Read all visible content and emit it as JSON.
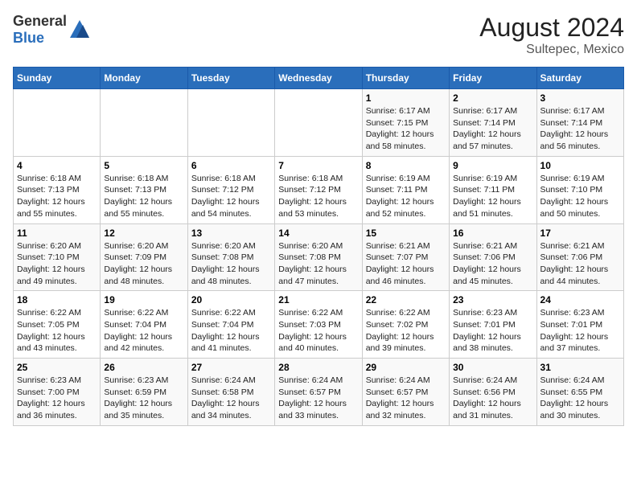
{
  "header": {
    "logo_general": "General",
    "logo_blue": "Blue",
    "title": "August 2024",
    "subtitle": "Sultepec, Mexico"
  },
  "days_of_week": [
    "Sunday",
    "Monday",
    "Tuesday",
    "Wednesday",
    "Thursday",
    "Friday",
    "Saturday"
  ],
  "weeks": [
    [
      {
        "day": "",
        "info": ""
      },
      {
        "day": "",
        "info": ""
      },
      {
        "day": "",
        "info": ""
      },
      {
        "day": "",
        "info": ""
      },
      {
        "day": "1",
        "info": "Sunrise: 6:17 AM\nSunset: 7:15 PM\nDaylight: 12 hours and 58 minutes."
      },
      {
        "day": "2",
        "info": "Sunrise: 6:17 AM\nSunset: 7:14 PM\nDaylight: 12 hours and 57 minutes."
      },
      {
        "day": "3",
        "info": "Sunrise: 6:17 AM\nSunset: 7:14 PM\nDaylight: 12 hours and 56 minutes."
      }
    ],
    [
      {
        "day": "4",
        "info": "Sunrise: 6:18 AM\nSunset: 7:13 PM\nDaylight: 12 hours and 55 minutes."
      },
      {
        "day": "5",
        "info": "Sunrise: 6:18 AM\nSunset: 7:13 PM\nDaylight: 12 hours and 55 minutes."
      },
      {
        "day": "6",
        "info": "Sunrise: 6:18 AM\nSunset: 7:12 PM\nDaylight: 12 hours and 54 minutes."
      },
      {
        "day": "7",
        "info": "Sunrise: 6:18 AM\nSunset: 7:12 PM\nDaylight: 12 hours and 53 minutes."
      },
      {
        "day": "8",
        "info": "Sunrise: 6:19 AM\nSunset: 7:11 PM\nDaylight: 12 hours and 52 minutes."
      },
      {
        "day": "9",
        "info": "Sunrise: 6:19 AM\nSunset: 7:11 PM\nDaylight: 12 hours and 51 minutes."
      },
      {
        "day": "10",
        "info": "Sunrise: 6:19 AM\nSunset: 7:10 PM\nDaylight: 12 hours and 50 minutes."
      }
    ],
    [
      {
        "day": "11",
        "info": "Sunrise: 6:20 AM\nSunset: 7:10 PM\nDaylight: 12 hours and 49 minutes."
      },
      {
        "day": "12",
        "info": "Sunrise: 6:20 AM\nSunset: 7:09 PM\nDaylight: 12 hours and 48 minutes."
      },
      {
        "day": "13",
        "info": "Sunrise: 6:20 AM\nSunset: 7:08 PM\nDaylight: 12 hours and 48 minutes."
      },
      {
        "day": "14",
        "info": "Sunrise: 6:20 AM\nSunset: 7:08 PM\nDaylight: 12 hours and 47 minutes."
      },
      {
        "day": "15",
        "info": "Sunrise: 6:21 AM\nSunset: 7:07 PM\nDaylight: 12 hours and 46 minutes."
      },
      {
        "day": "16",
        "info": "Sunrise: 6:21 AM\nSunset: 7:06 PM\nDaylight: 12 hours and 45 minutes."
      },
      {
        "day": "17",
        "info": "Sunrise: 6:21 AM\nSunset: 7:06 PM\nDaylight: 12 hours and 44 minutes."
      }
    ],
    [
      {
        "day": "18",
        "info": "Sunrise: 6:22 AM\nSunset: 7:05 PM\nDaylight: 12 hours and 43 minutes."
      },
      {
        "day": "19",
        "info": "Sunrise: 6:22 AM\nSunset: 7:04 PM\nDaylight: 12 hours and 42 minutes."
      },
      {
        "day": "20",
        "info": "Sunrise: 6:22 AM\nSunset: 7:04 PM\nDaylight: 12 hours and 41 minutes."
      },
      {
        "day": "21",
        "info": "Sunrise: 6:22 AM\nSunset: 7:03 PM\nDaylight: 12 hours and 40 minutes."
      },
      {
        "day": "22",
        "info": "Sunrise: 6:22 AM\nSunset: 7:02 PM\nDaylight: 12 hours and 39 minutes."
      },
      {
        "day": "23",
        "info": "Sunrise: 6:23 AM\nSunset: 7:01 PM\nDaylight: 12 hours and 38 minutes."
      },
      {
        "day": "24",
        "info": "Sunrise: 6:23 AM\nSunset: 7:01 PM\nDaylight: 12 hours and 37 minutes."
      }
    ],
    [
      {
        "day": "25",
        "info": "Sunrise: 6:23 AM\nSunset: 7:00 PM\nDaylight: 12 hours and 36 minutes."
      },
      {
        "day": "26",
        "info": "Sunrise: 6:23 AM\nSunset: 6:59 PM\nDaylight: 12 hours and 35 minutes."
      },
      {
        "day": "27",
        "info": "Sunrise: 6:24 AM\nSunset: 6:58 PM\nDaylight: 12 hours and 34 minutes."
      },
      {
        "day": "28",
        "info": "Sunrise: 6:24 AM\nSunset: 6:57 PM\nDaylight: 12 hours and 33 minutes."
      },
      {
        "day": "29",
        "info": "Sunrise: 6:24 AM\nSunset: 6:57 PM\nDaylight: 12 hours and 32 minutes."
      },
      {
        "day": "30",
        "info": "Sunrise: 6:24 AM\nSunset: 6:56 PM\nDaylight: 12 hours and 31 minutes."
      },
      {
        "day": "31",
        "info": "Sunrise: 6:24 AM\nSunset: 6:55 PM\nDaylight: 12 hours and 30 minutes."
      }
    ]
  ]
}
